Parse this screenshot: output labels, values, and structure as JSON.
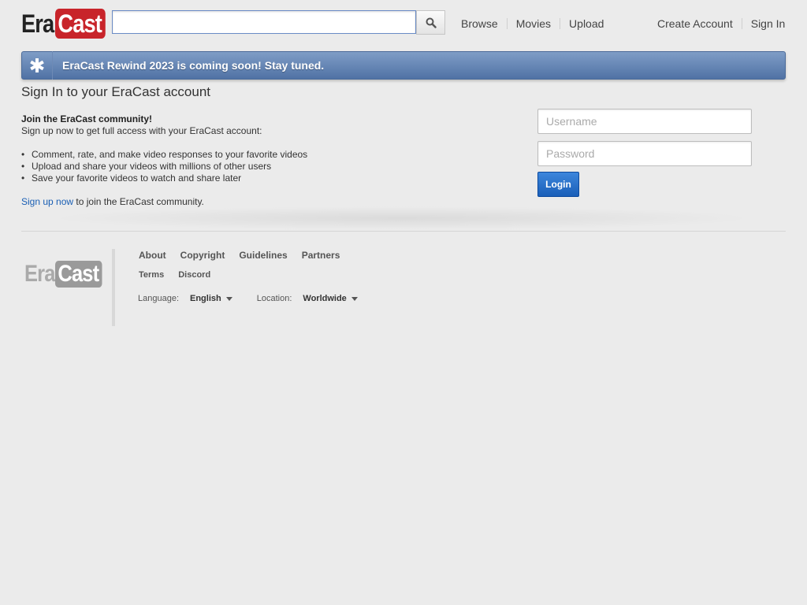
{
  "header": {
    "logo_left": "Era",
    "logo_right": "Cast",
    "search_value": "",
    "search_button_icon": "search-icon",
    "nav_left": [
      "Browse",
      "Movies",
      "Upload"
    ],
    "nav_right": [
      "Create Account",
      "Sign In"
    ]
  },
  "banner": {
    "icon": "asterisk-icon",
    "text": "EraCast Rewind 2023 is coming soon! Stay tuned."
  },
  "main": {
    "title": "Sign In to your EraCast account",
    "join_heading": "Join the EraCast community!",
    "join_subtitle": "Sign up now to get full access with your EraCast account:",
    "benefits": [
      "Comment, rate, and make video responses to your favorite videos",
      "Upload and share your videos with millions of other users",
      "Save your favorite videos to watch and share later"
    ],
    "signup_link": "Sign up now",
    "signup_rest": " to join the EraCast community."
  },
  "login": {
    "username_placeholder": "Username",
    "password_placeholder": "Password",
    "button_label": "Login"
  },
  "footer": {
    "logo_left": "Era",
    "logo_right": "Cast",
    "links_row1": [
      "About",
      "Copyright",
      "Guidelines",
      "Partners"
    ],
    "links_row2": [
      "Terms",
      "Discord"
    ],
    "language_label": "Language:",
    "language_value": "English",
    "location_label": "Location:",
    "location_value": "Worldwide"
  },
  "colors": {
    "brand_red": "#c8242a",
    "banner_blue": "#5f7fb0",
    "link_blue": "#1a5fb4",
    "button_blue": "#2a6fca"
  }
}
